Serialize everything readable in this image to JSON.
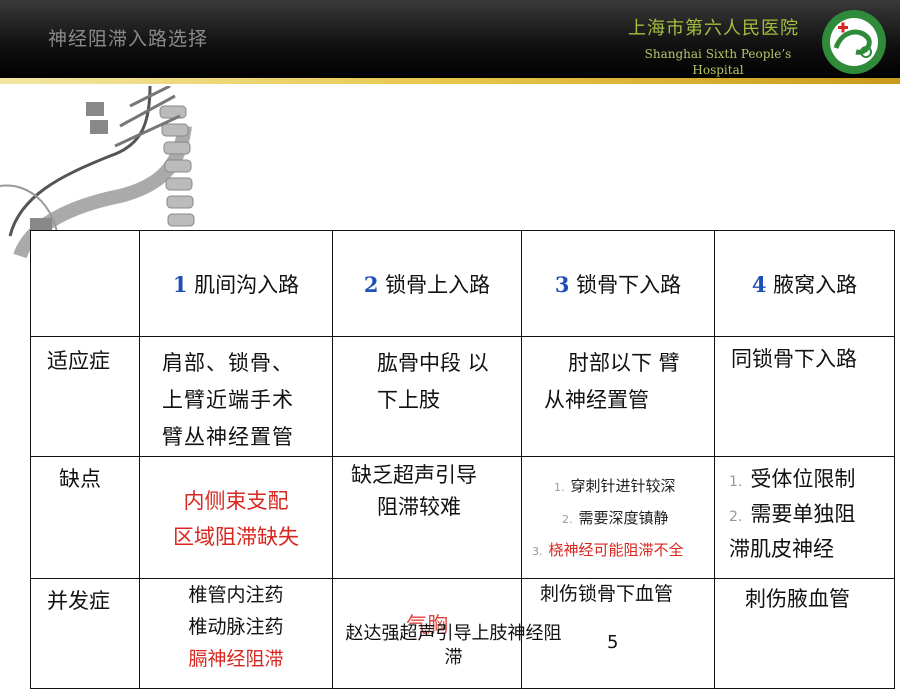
{
  "header": {
    "title": "神经阻滞入路选择",
    "hospital_cn": "上海市第六人民医院",
    "hospital_en_line1": "Shanghai Sixth People’s",
    "hospital_en_line2": "Hospital"
  },
  "table": {
    "col_headers": [
      {
        "num": "1",
        "label": "肌间沟入路"
      },
      {
        "num": "2",
        "label": "锁骨上入路"
      },
      {
        "num": "3",
        "label": "锁骨下入路"
      },
      {
        "num": "4",
        "label": "腋窝入路"
      }
    ],
    "rows": {
      "indication": {
        "label": "适应症",
        "c1": [
          "肩部、锁骨、",
          "上臂近端手术",
          "臂丛神经置管"
        ],
        "c2": [
          "肱骨中段 以",
          "下上肢"
        ],
        "c3": [
          "肘部以下 臂",
          "从神经置管"
        ],
        "c4": [
          "同锁骨下入路"
        ]
      },
      "drawback": {
        "label": "缺点",
        "c1": [
          "内侧束支配",
          "区域阻滞缺失"
        ],
        "c2": [
          "缺乏超声引导",
          "阻滞较难"
        ],
        "c3": [
          {
            "idx": "1.",
            "text": "穿刺针进针较深"
          },
          {
            "idx": "2.",
            "text": "需要深度镇静"
          },
          {
            "idx": "3.",
            "text": "桡神经可能阻滞不全"
          }
        ],
        "c4": [
          {
            "idx": "1.",
            "text": "受体位限制"
          },
          {
            "idx": "2.",
            "text": "需要单独阻"
          },
          {
            "idx": "",
            "text": "滞肌皮神经"
          }
        ]
      },
      "complication": {
        "label": "并发症",
        "c1": [
          "椎管内注药",
          "椎动脉注药",
          "膈神经阻滞"
        ],
        "c2": [
          "气胸"
        ],
        "c3": [
          "刺伤锁骨下血管"
        ],
        "c4": [
          "刺伤腋血管"
        ]
      }
    }
  },
  "footer": {
    "line1": "赵达强超声引导上肢神经阻",
    "line2": "滞",
    "page": "5"
  },
  "colors": {
    "accent_blue": "#1f4fb5",
    "alert_red": "#d8271f",
    "hospital_green": "#a4bf3c",
    "header_gold": "#e7c64a"
  }
}
